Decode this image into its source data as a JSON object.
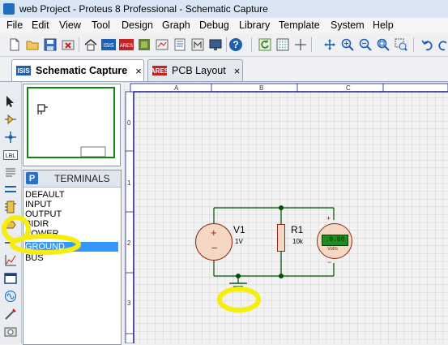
{
  "window": {
    "title": "web Project - Proteus 8 Professional - Schematic Capture"
  },
  "menu": [
    "File",
    "Edit",
    "View",
    "Tool",
    "Design",
    "Graph",
    "Debug",
    "Library",
    "Template",
    "System",
    "Help"
  ],
  "tabs": [
    {
      "label": "Schematic Capture",
      "icon": "ISIS",
      "close": "×",
      "active": true
    },
    {
      "label": "PCB Layout",
      "icon": "ARES",
      "close": "×",
      "active": false
    }
  ],
  "terminals_panel": {
    "button": "P",
    "title": "TERMINALS",
    "items": [
      "DEFAULT",
      "INPUT",
      "OUTPUT",
      "BIDIR",
      "POWER",
      "GROUND",
      "BUS"
    ],
    "selected": "GROUND"
  },
  "ruler": {
    "columns": [
      "A",
      "B",
      "C"
    ],
    "rows": [
      "0",
      "1",
      "2",
      "3"
    ]
  },
  "schematic": {
    "v1": {
      "ref": "V1",
      "value": "1V"
    },
    "r1": {
      "ref": "R1",
      "value": "10k"
    },
    "voltmeter": {
      "reading": ".0.00",
      "unit": "Volts",
      "plus": "+",
      "minus": "−"
    },
    "source_plus": "+",
    "source_minus": "−"
  },
  "colors": {
    "highlight": "#f5ee0c",
    "component_outline": "#8a2a1a",
    "component_fill": "#f4d8c4",
    "wire": "#005000",
    "junction": "#005000",
    "display_green": "#1d8d1d",
    "selection": "#3399ff",
    "sheet_border": "#1a1a8c"
  }
}
